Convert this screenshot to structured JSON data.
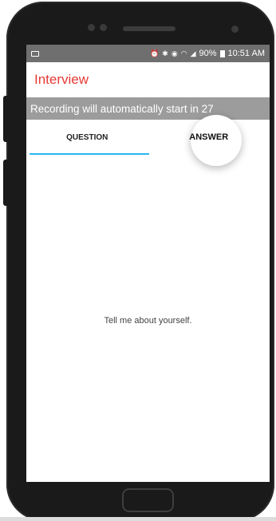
{
  "status_bar": {
    "battery": "90%",
    "time": "10:51 AM"
  },
  "app_bar": {
    "title": "Interview"
  },
  "banner": {
    "text": "Recording will automatically start in 27"
  },
  "tabs": [
    {
      "label": "QUESTION",
      "selected": true
    },
    {
      "label": "ANSWER",
      "selected": false
    }
  ],
  "content": {
    "question": "Tell me about yourself."
  },
  "colors": {
    "accent": "#e53935",
    "tab_indicator": "#29b6f6",
    "banner_bg": "#9c9c9c",
    "status_bg": "#6f6f6f"
  }
}
